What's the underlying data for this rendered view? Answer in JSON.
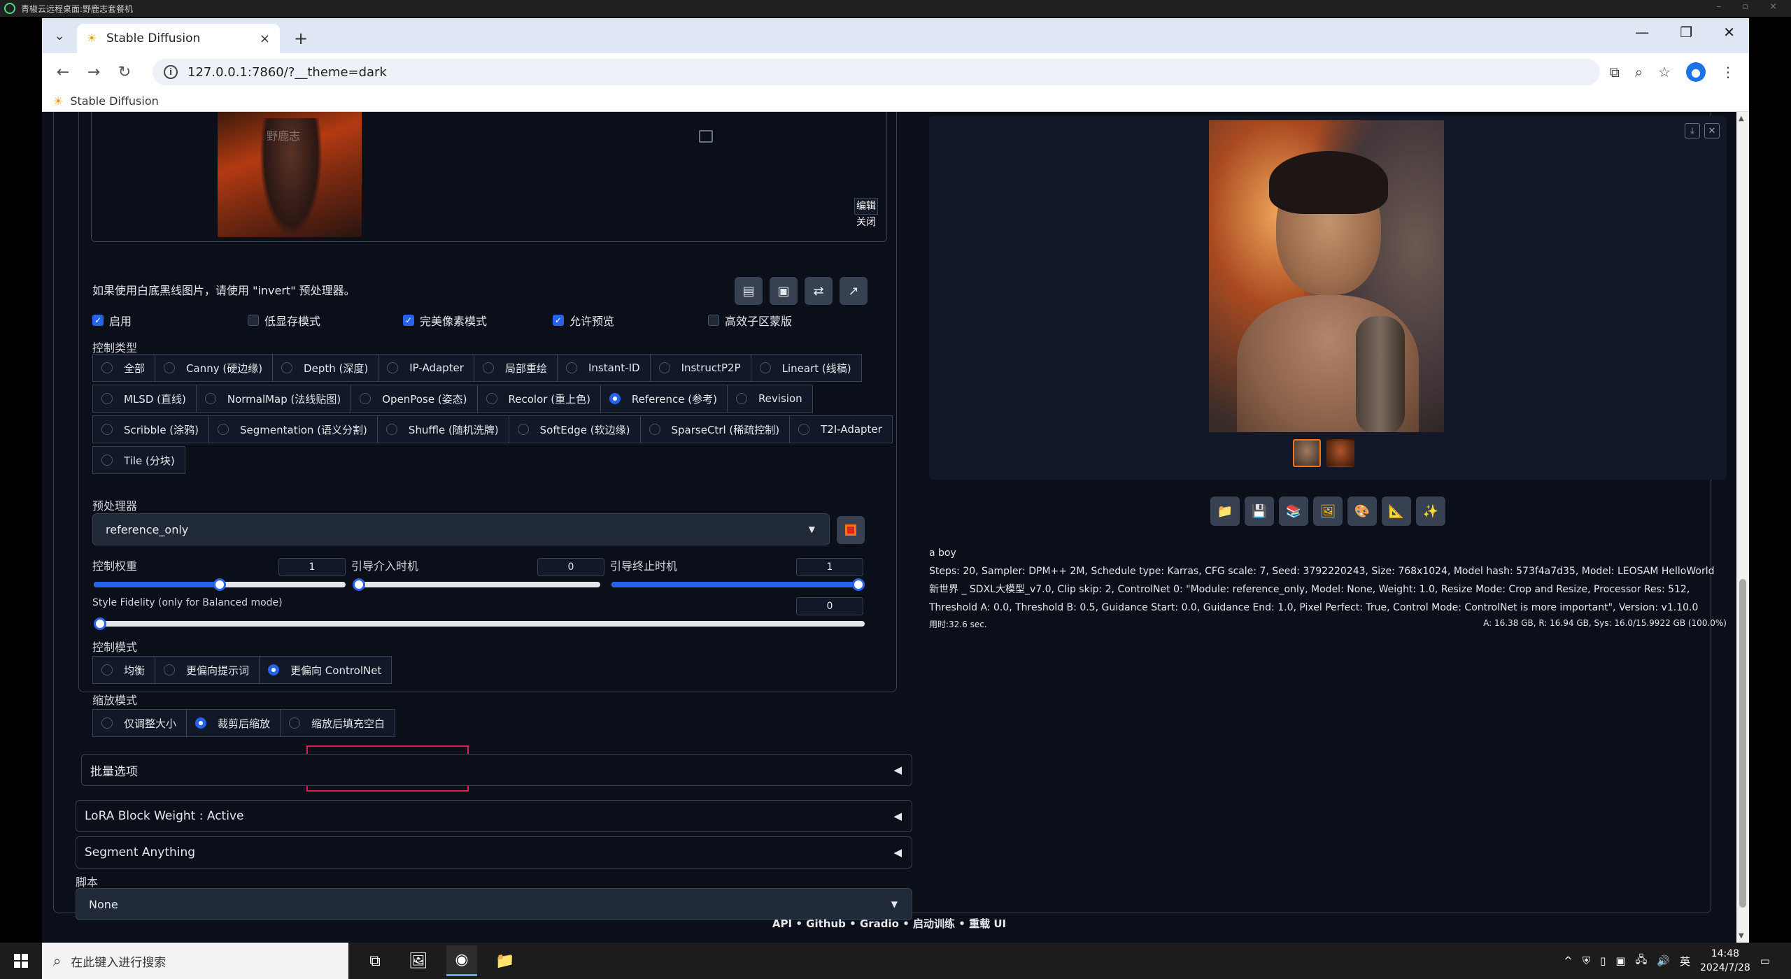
{
  "host": {
    "title": "青椒云远程桌面:野鹿志套餐机"
  },
  "browser": {
    "tab_title": "Stable Diffusion",
    "url": "127.0.0.1:7860/?__theme=dark",
    "bookmark": "Stable Diffusion"
  },
  "controlnet": {
    "hint": "如果使用白底黑线图片，请使用 \"invert\" 预处理器。",
    "edit_label": "编辑",
    "close_label": "关闭",
    "watermark": "野鹿志",
    "checkboxes": [
      {
        "label": "启用",
        "checked": true
      },
      {
        "label": "低显存模式",
        "checked": false
      },
      {
        "label": "完美像素模式",
        "checked": true
      },
      {
        "label": "允许预览",
        "checked": true
      },
      {
        "label": "高效子区蒙版",
        "checked": false
      }
    ],
    "control_type_label": "控制类型",
    "control_types_row1": [
      "全部",
      "Canny (硬边缘)",
      "Depth (深度)",
      "IP-Adapter",
      "局部重绘",
      "Instant-ID",
      "InstructP2P",
      "Lineart (线稿)"
    ],
    "control_types_row2": [
      "MLSD (直线)",
      "NormalMap (法线贴图)",
      "OpenPose (姿态)",
      "Recolor (重上色)",
      "Reference (参考)",
      "Revision"
    ],
    "control_types_row3": [
      "Scribble (涂鸦)",
      "Segmentation (语义分割)",
      "Shuffle (随机洗牌)",
      "SoftEdge (软边缘)",
      "SparseCtrl (稀疏控制)",
      "T2I-Adapter"
    ],
    "control_types_row4": [
      "Tile (分块)"
    ],
    "selected_control_type": "Reference (参考)",
    "preprocessor_label": "预处理器",
    "preprocessor_value": "reference_only",
    "weight_label": "控制权重",
    "weight_value": "1",
    "weight_fraction": 0.5,
    "start_label": "引导介入时机",
    "start_value": "0",
    "start_fraction": 0.0,
    "end_label": "引导终止时机",
    "end_value": "1",
    "end_fraction": 1.0,
    "fidelity_label": "Style Fidelity (only for Balanced mode)",
    "fidelity_value": "0",
    "fidelity_fraction": 0.0,
    "control_mode_label": "控制模式",
    "control_modes": [
      "均衡",
      "更偏向提示词",
      "更偏向 ControlNet"
    ],
    "selected_control_mode": "更偏向 ControlNet",
    "resize_mode_label": "缩放模式",
    "resize_modes": [
      "仅调整大小",
      "裁剪后缩放",
      "缩放后填充空白"
    ],
    "selected_resize_mode": "裁剪后缩放"
  },
  "accordions": {
    "batch": "批量选项",
    "lora": "LoRA Block Weight : Active",
    "segment": "Segment Anything"
  },
  "script": {
    "label": "脚本",
    "value": "None"
  },
  "output": {
    "prompt": "a boy",
    "params": "Steps: 20, Sampler: DPM++ 2M, Schedule type: Karras, CFG scale: 7, Seed: 3792220243, Size: 768x1024, Model hash: 573f4a7d35, Model: LEOSAM HelloWorld 新世界 _ SDXL大模型_v7.0, Clip skip: 2, ControlNet 0: \"Module: reference_only, Model: None, Weight: 1.0, Resize Mode: Crop and Resize, Processor Res: 512, Threshold A: 0.0, Threshold B: 0.5, Guidance Start: 0.0, Guidance End: 1.0, Pixel Perfect: True, Control Mode: ControlNet is more important\", Version: v1.10.0",
    "time": "用时:32.6 sec.",
    "vram": "A: 16.38 GB, R: 16.94 GB, Sys: 16.0/15.9922 GB (100.0%)"
  },
  "footer": {
    "items": [
      "API",
      "•",
      "Github",
      "•",
      "Gradio",
      "•",
      "启动训练",
      "•",
      "重载 UI"
    ]
  },
  "taskbar": {
    "search_placeholder": "在此键入进行搜索",
    "ime": "英",
    "time": "14:48",
    "date": "2024/7/28"
  }
}
